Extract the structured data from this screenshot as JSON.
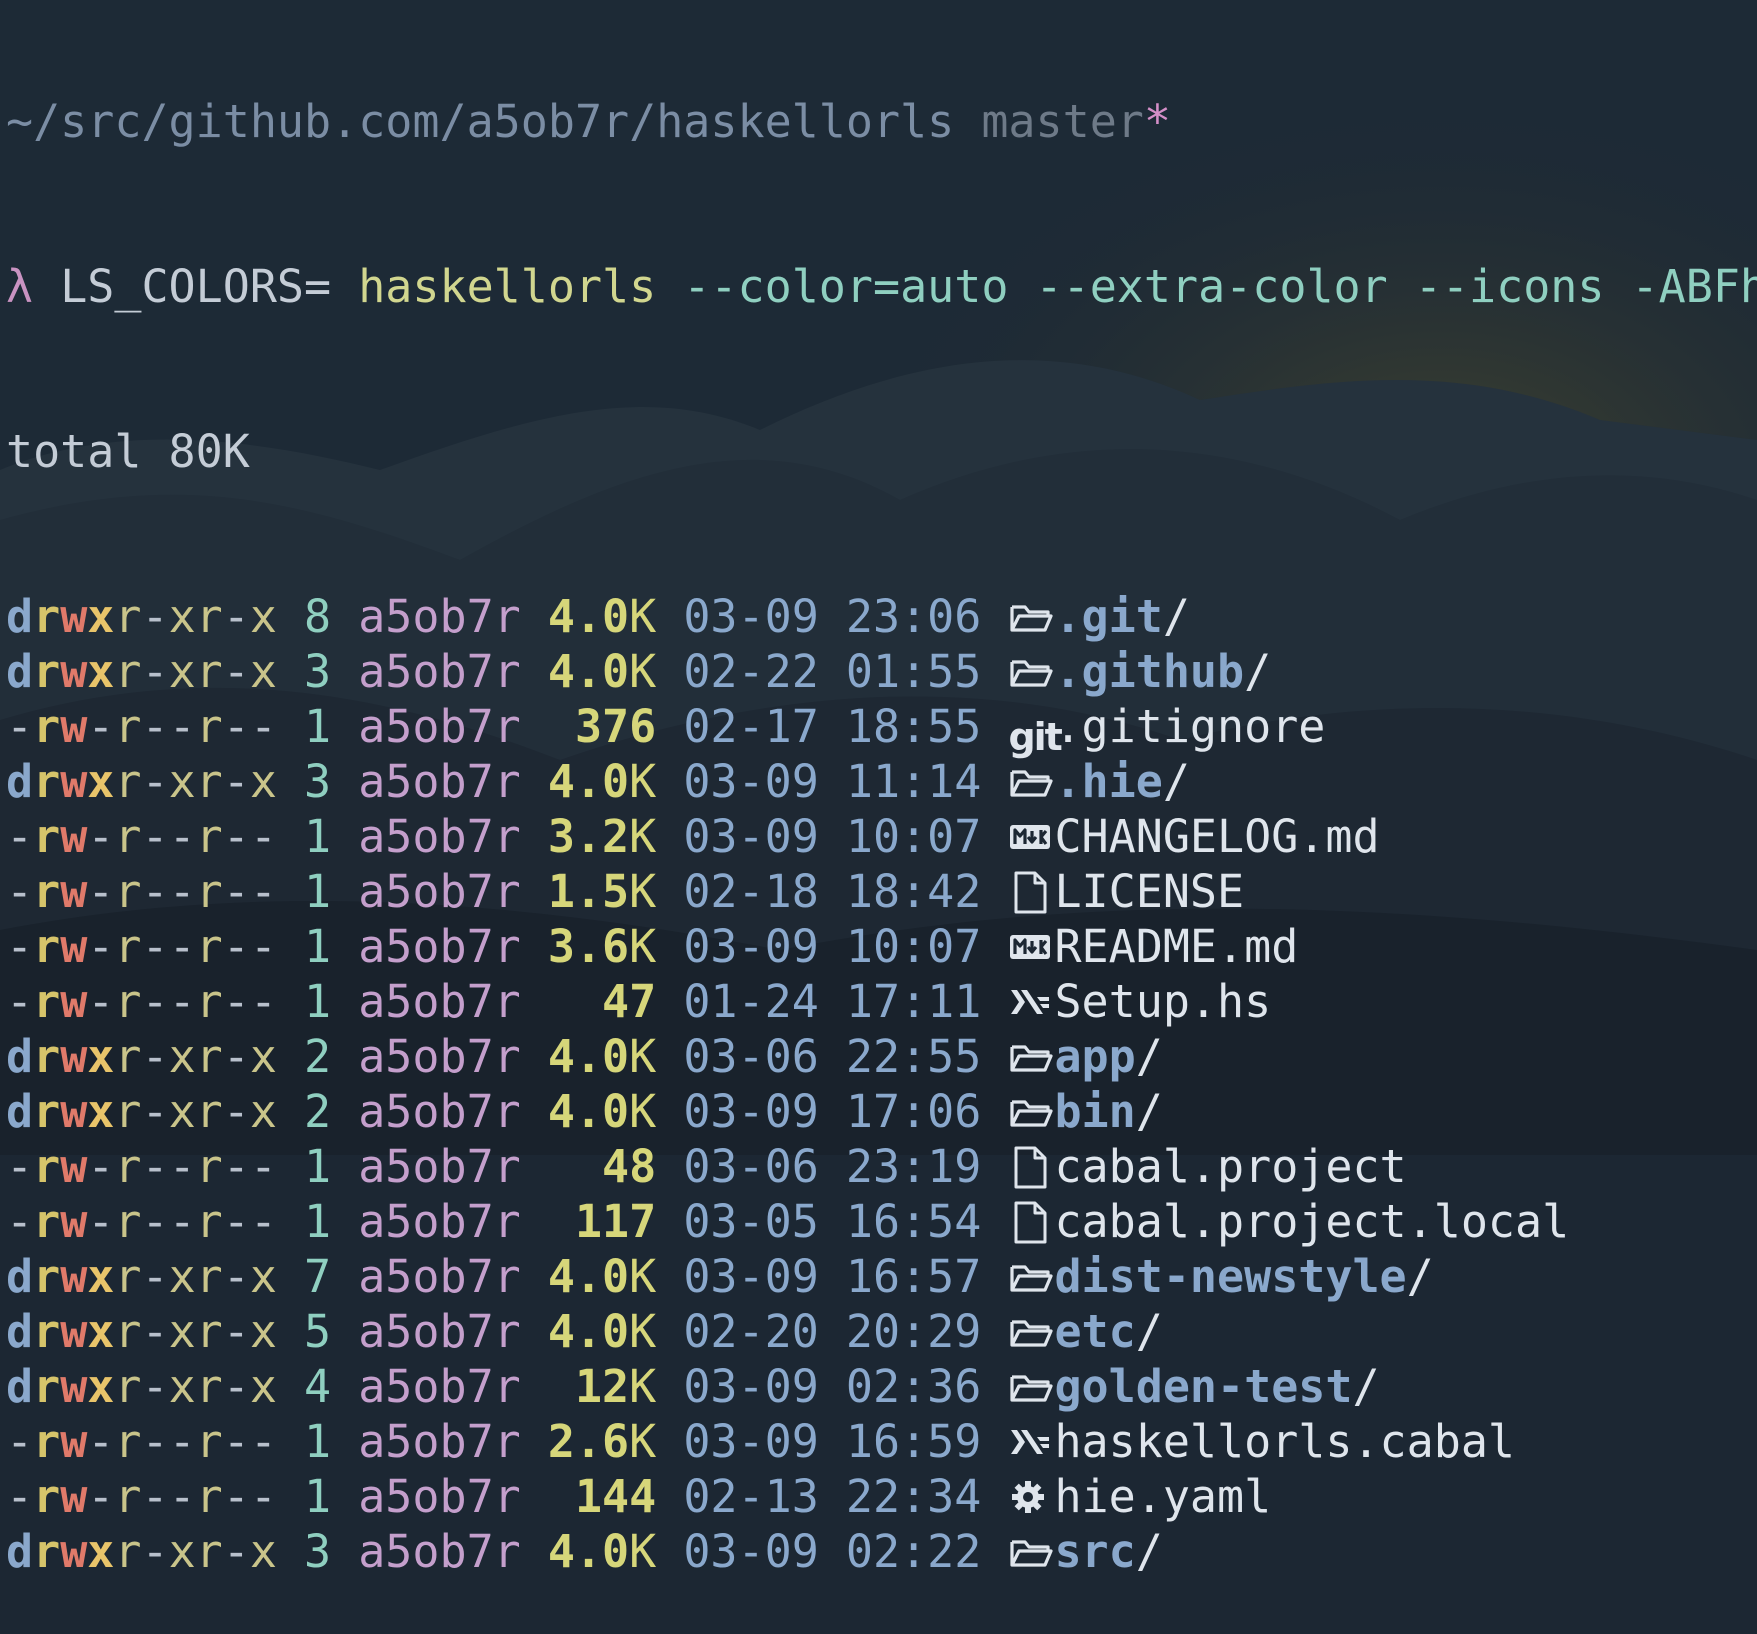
{
  "prompt": {
    "path": "~/src/github.com/a5ob7r/haskellorls",
    "branch": "master",
    "dirty_marker": "*"
  },
  "command": {
    "prompt_symbol": "λ",
    "env": "LS_COLORS=",
    "program": "haskellorls",
    "args": "--color=auto --extra-color --icons -ABFhvo"
  },
  "total": "total 80K",
  "entries": [
    {
      "perm": "drwxr-xr-x",
      "links": "8",
      "owner": "a5ob7r",
      "size": "4.0",
      "unit": "K",
      "date": "03-09 23:06",
      "icon": "folder-icon",
      "name": ".git",
      "suffix": "/",
      "kind": "dir"
    },
    {
      "perm": "drwxr-xr-x",
      "links": "3",
      "owner": "a5ob7r",
      "size": "4.0",
      "unit": "K",
      "date": "02-22 01:55",
      "icon": "folder-icon",
      "name": ".github",
      "suffix": "/",
      "kind": "dir"
    },
    {
      "perm": "-rw-r--r--",
      "links": "1",
      "owner": "a5ob7r",
      "size": " 376",
      "unit": "",
      "date": "02-17 18:55",
      "icon": "git-icon",
      "name": ".gitignore",
      "suffix": "",
      "kind": "file"
    },
    {
      "perm": "drwxr-xr-x",
      "links": "3",
      "owner": "a5ob7r",
      "size": "4.0",
      "unit": "K",
      "date": "03-09 11:14",
      "icon": "folder-icon",
      "name": ".hie",
      "suffix": "/",
      "kind": "dir"
    },
    {
      "perm": "-rw-r--r--",
      "links": "1",
      "owner": "a5ob7r",
      "size": "3.2",
      "unit": "K",
      "date": "03-09 10:07",
      "icon": "markdown-icon",
      "name": "CHANGELOG.md",
      "suffix": "",
      "kind": "file"
    },
    {
      "perm": "-rw-r--r--",
      "links": "1",
      "owner": "a5ob7r",
      "size": "1.5",
      "unit": "K",
      "date": "02-18 18:42",
      "icon": "file-icon",
      "name": "LICENSE",
      "suffix": "",
      "kind": "file"
    },
    {
      "perm": "-rw-r--r--",
      "links": "1",
      "owner": "a5ob7r",
      "size": "3.6",
      "unit": "K",
      "date": "03-09 10:07",
      "icon": "markdown-icon",
      "name": "README.md",
      "suffix": "",
      "kind": "file"
    },
    {
      "perm": "-rw-r--r--",
      "links": "1",
      "owner": "a5ob7r",
      "size": "  47",
      "unit": "",
      "date": "01-24 17:11",
      "icon": "haskell-icon",
      "name": "Setup.hs",
      "suffix": "",
      "kind": "file"
    },
    {
      "perm": "drwxr-xr-x",
      "links": "2",
      "owner": "a5ob7r",
      "size": "4.0",
      "unit": "K",
      "date": "03-06 22:55",
      "icon": "folder-icon",
      "name": "app",
      "suffix": "/",
      "kind": "dir"
    },
    {
      "perm": "drwxr-xr-x",
      "links": "2",
      "owner": "a5ob7r",
      "size": "4.0",
      "unit": "K",
      "date": "03-09 17:06",
      "icon": "folder-icon",
      "name": "bin",
      "suffix": "/",
      "kind": "dir"
    },
    {
      "perm": "-rw-r--r--",
      "links": "1",
      "owner": "a5ob7r",
      "size": "  48",
      "unit": "",
      "date": "03-06 23:19",
      "icon": "file-icon",
      "name": "cabal.project",
      "suffix": "",
      "kind": "file"
    },
    {
      "perm": "-rw-r--r--",
      "links": "1",
      "owner": "a5ob7r",
      "size": " 117",
      "unit": "",
      "date": "03-05 16:54",
      "icon": "file-icon",
      "name": "cabal.project.local",
      "suffix": "",
      "kind": "file"
    },
    {
      "perm": "drwxr-xr-x",
      "links": "7",
      "owner": "a5ob7r",
      "size": "4.0",
      "unit": "K",
      "date": "03-09 16:57",
      "icon": "folder-icon",
      "name": "dist-newstyle",
      "suffix": "/",
      "kind": "dir"
    },
    {
      "perm": "drwxr-xr-x",
      "links": "5",
      "owner": "a5ob7r",
      "size": "4.0",
      "unit": "K",
      "date": "02-20 20:29",
      "icon": "folder-icon",
      "name": "etc",
      "suffix": "/",
      "kind": "dir"
    },
    {
      "perm": "drwxr-xr-x",
      "links": "4",
      "owner": "a5ob7r",
      "size": " 12",
      "unit": "K",
      "date": "03-09 02:36",
      "icon": "folder-icon",
      "name": "golden-test",
      "suffix": "/",
      "kind": "dir"
    },
    {
      "perm": "-rw-r--r--",
      "links": "1",
      "owner": "a5ob7r",
      "size": "2.6",
      "unit": "K",
      "date": "03-09 16:59",
      "icon": "haskell-icon",
      "name": "haskellorls.cabal",
      "suffix": "",
      "kind": "file"
    },
    {
      "perm": "-rw-r--r--",
      "links": "1",
      "owner": "a5ob7r",
      "size": " 144",
      "unit": "",
      "date": "02-13 22:34",
      "icon": "gear-icon",
      "name": "hie.yaml",
      "suffix": "",
      "kind": "file"
    },
    {
      "perm": "drwxr-xr-x",
      "links": "3",
      "owner": "a5ob7r",
      "size": "4.0",
      "unit": "K",
      "date": "03-09 02:22",
      "icon": "folder-icon",
      "name": "src",
      "suffix": "/",
      "kind": "dir"
    }
  ],
  "colors": {
    "background": "#1c2733",
    "directory": "#8aa8cc",
    "size": "#d6d67a",
    "owner": "#c49fcc",
    "date": "#8aa8cc",
    "flags": "#8fcfc0",
    "command": "#d1d68f"
  }
}
